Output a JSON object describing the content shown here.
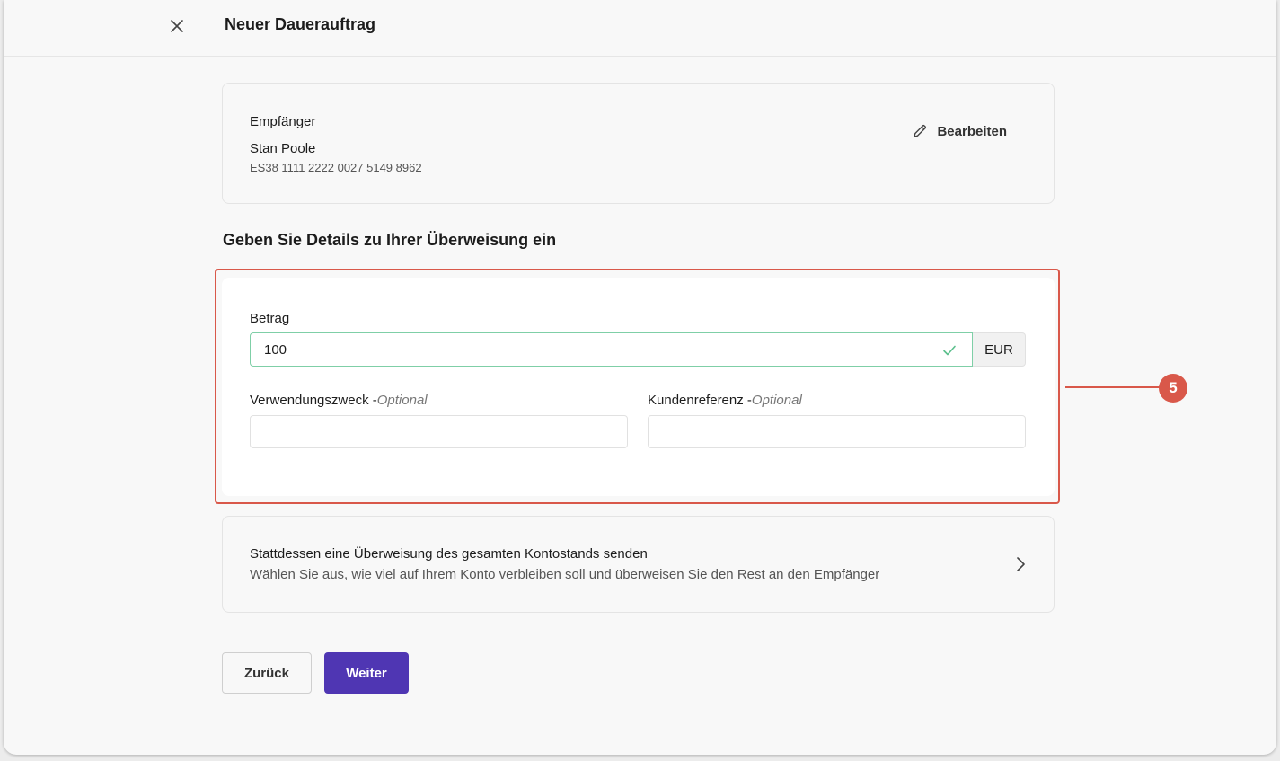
{
  "header": {
    "title": "Neuer Dauerauftrag",
    "close_icon": "close-icon"
  },
  "recipient": {
    "label": "Empfänger",
    "name": "Stan Poole",
    "iban": "ES38 1111 2222 0027 5149 8962",
    "edit_label": "Bearbeiten",
    "edit_icon": "pencil-icon"
  },
  "details": {
    "heading": "Geben Sie Details zu Ihrer Überweisung ein",
    "amount": {
      "label": "Betrag",
      "value": "100",
      "currency": "EUR",
      "valid_icon": "check-icon"
    },
    "purpose": {
      "label": "Verwendungszweck -",
      "optional": "Optional",
      "value": ""
    },
    "reference": {
      "label": "Kundenreferenz -",
      "optional": "Optional",
      "value": ""
    }
  },
  "annotation": {
    "badge": "5",
    "color": "#d9584a"
  },
  "full_balance": {
    "title": "Stattdessen eine Überweisung des gesamten Kontostands senden",
    "description": "Wählen Sie aus, wie viel auf Ihrem Konto verbleiben soll und überweisen Sie den Rest an den Empfänger",
    "icon": "chevron-right-icon"
  },
  "actions": {
    "back_label": "Zurück",
    "next_label": "Weiter",
    "primary_color": "#4f36b3"
  }
}
